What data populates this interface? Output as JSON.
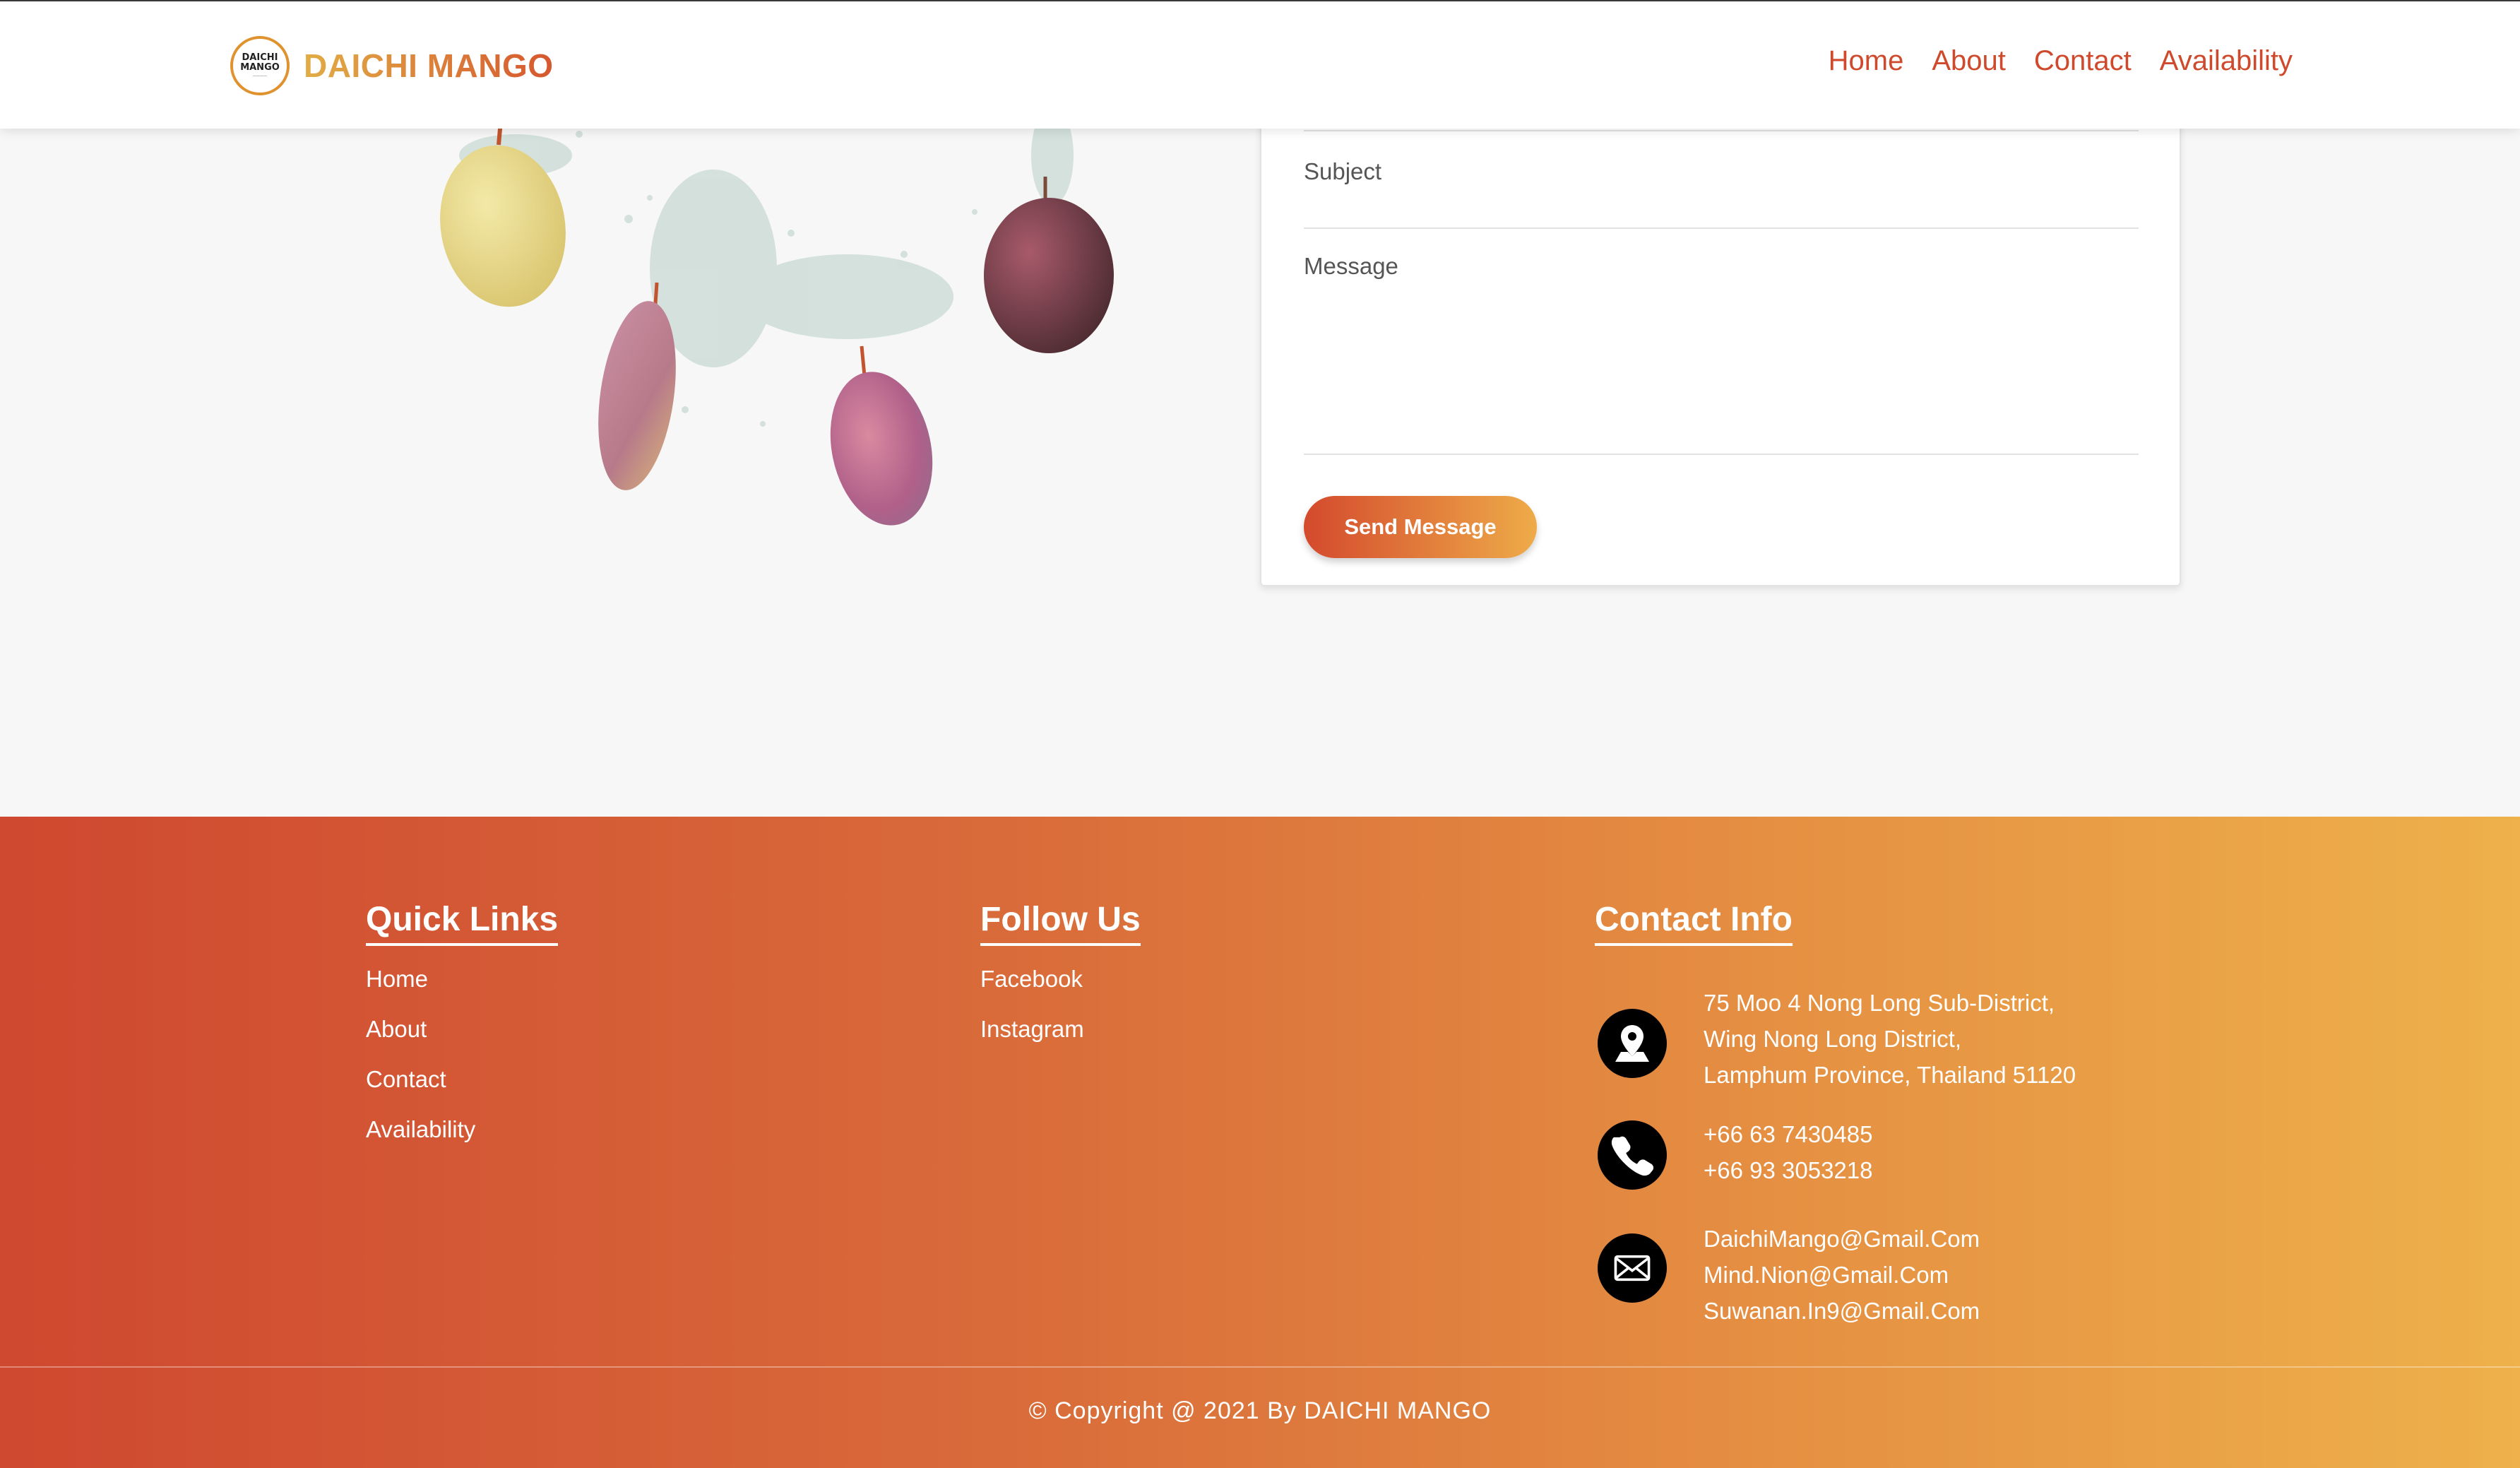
{
  "header": {
    "brand": "DAICHI MANGO",
    "logo_text_line1": "DAICHI",
    "logo_text_line2": "MANGO",
    "nav": [
      "Home",
      "About",
      "Contact",
      "Availability"
    ]
  },
  "form": {
    "subject_label": "Subject",
    "message_label": "Message",
    "send_label": "Send Message"
  },
  "footer": {
    "quick_links_title": "Quick Links",
    "quick_links": [
      "Home",
      "About",
      "Contact",
      "Availability"
    ],
    "follow_title": "Follow Us",
    "follow_links": [
      "Facebook",
      "Instagram"
    ],
    "contact_title": "Contact Info",
    "address": [
      "75 Moo 4 Nong Long Sub-District,",
      "Wing Nong Long District,",
      "Lamphum Province, Thailand 51120"
    ],
    "phones": [
      "+66 63 7430485",
      "+66 93 3053218"
    ],
    "emails": [
      "DaichiMango@Gmail.Com",
      "Mind.Nion@Gmail.Com",
      "Suwanan.In9@Gmail.Com"
    ],
    "copyright": "© Copyright @ 2021 By DAICHI MANGO"
  },
  "colors": {
    "brand_red": "#cf4a2c",
    "brand_gold": "#eeb14b",
    "background": "#f7f7f7"
  },
  "icons": [
    "location-icon",
    "phone-icon",
    "mail-icon"
  ]
}
